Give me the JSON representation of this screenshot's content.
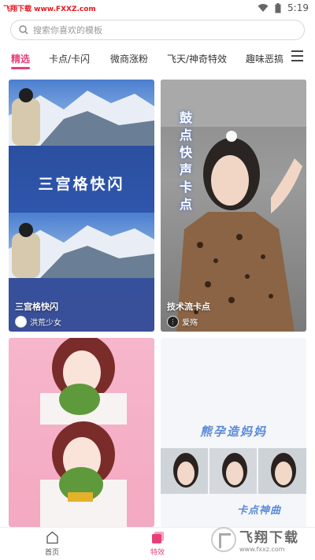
{
  "status_bar": {
    "site_watermark": "飞翔下载 www.FXXZ.com",
    "time": "5:19"
  },
  "search": {
    "placeholder": "搜索你喜欢的模板"
  },
  "tabs": [
    {
      "label": "精选",
      "active": true
    },
    {
      "label": "卡点/卡闪",
      "active": false
    },
    {
      "label": "微商涨粉",
      "active": false
    },
    {
      "label": "飞天/神奇特效",
      "active": false
    },
    {
      "label": "趣味恶搞",
      "active": false
    }
  ],
  "cards": [
    {
      "title": "三宫格快闪",
      "overlay": "三宫格快闪",
      "author": "洪荒少女"
    },
    {
      "title": "技术流卡点",
      "overlay": "鼓点 快声 卡点",
      "author": "爱殇"
    },
    {
      "title": "",
      "overlay": "",
      "author": ""
    },
    {
      "title": "",
      "overlay_top": "熊孕造妈妈",
      "overlay_bottom": "卡点神曲",
      "author": ""
    }
  ],
  "bottom_nav": [
    {
      "label": "首页",
      "icon": "home-icon",
      "active": false
    },
    {
      "label": "特效",
      "icon": "effects-icon",
      "active": true
    }
  ],
  "watermark": {
    "cn": "飞翔下载",
    "en": "www.fxxz.com"
  },
  "colors": {
    "accent": "#e93f77"
  }
}
